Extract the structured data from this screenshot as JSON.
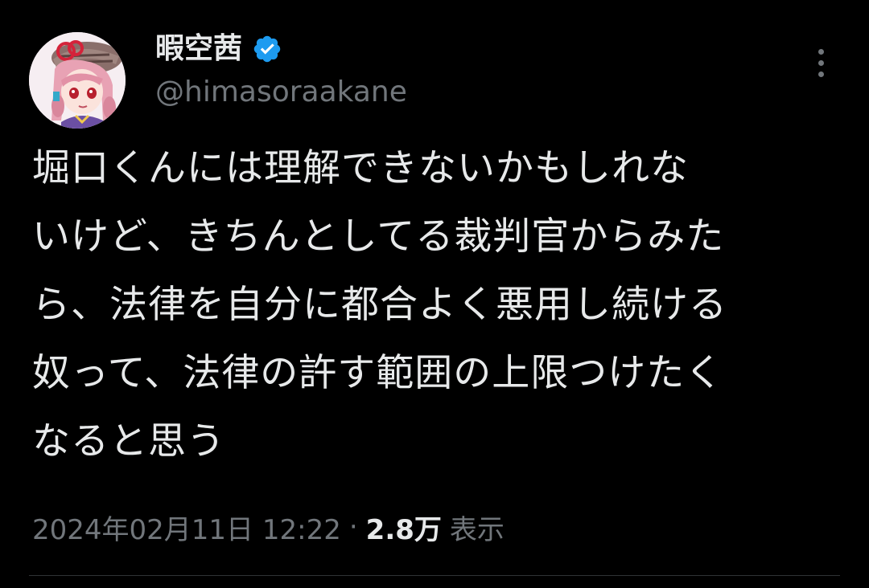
{
  "author": {
    "display_name": "暇空茜",
    "handle": "@himasoraakane",
    "verified": true,
    "verified_color": "#1d9bf0"
  },
  "tweet": {
    "text_lines": [
      "堀口くんには理解できないかもしれな",
      "いけど、きちんとしてる裁判官からみた",
      "ら、法律を自分に都合よく悪用し続ける",
      "奴って、法律の許す範囲の上限つけたく",
      "なると思う"
    ]
  },
  "meta": {
    "timestamp": "2024年02月11日 12:22",
    "separator": "·",
    "views_count": "2.8万",
    "views_label": "表示"
  },
  "icons": {
    "verified": "verified-badge-icon",
    "more": "more-options-icon"
  },
  "colors": {
    "background": "#000000",
    "primary_text": "#e7e9ea",
    "secondary_text": "#71767b"
  }
}
